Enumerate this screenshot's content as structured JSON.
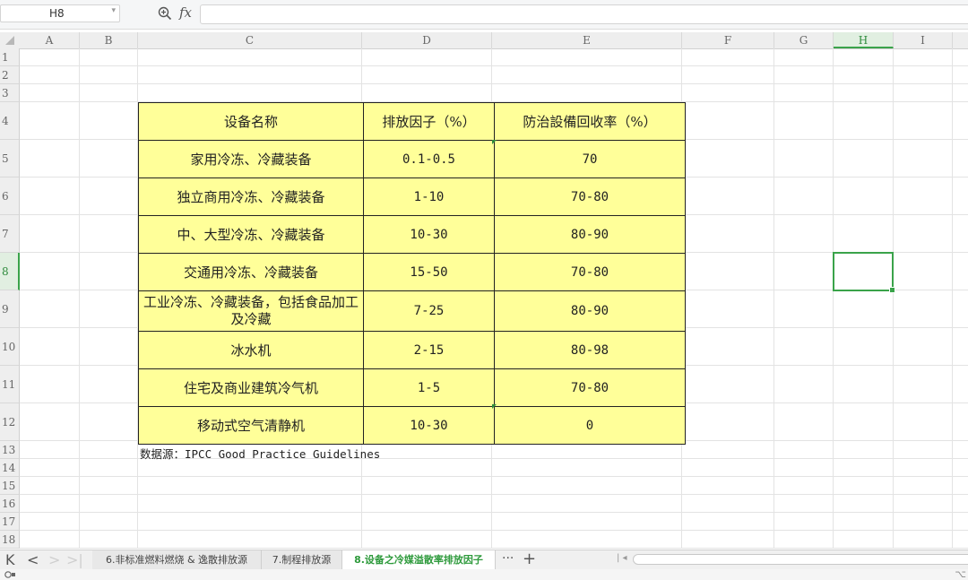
{
  "formula_bar": {
    "name_box": "H8",
    "fx_label": "fx",
    "formula": ""
  },
  "columns": [
    "A",
    "B",
    "C",
    "D",
    "E",
    "F",
    "G",
    "H",
    "I"
  ],
  "active_column": "H",
  "rows": [
    "1",
    "2",
    "3",
    "4",
    "5",
    "6",
    "7",
    "8",
    "9",
    "10",
    "11",
    "12",
    "13",
    "14",
    "15",
    "16",
    "17",
    "18"
  ],
  "active_row": "8",
  "table": {
    "headers": [
      "设备名称",
      "排放因子（%）",
      "防治設備回收率（%）"
    ],
    "rows": [
      [
        "家用冷冻、冷藏装备",
        "0.1-0.5",
        "70"
      ],
      [
        "独立商用冷冻、冷藏装备",
        "1-10",
        "70-80"
      ],
      [
        "中、大型冷冻、冷藏装备",
        "10-30",
        "80-90"
      ],
      [
        "交通用冷冻、冷藏装备",
        "15-50",
        "70-80"
      ],
      [
        "工业冷冻、冷藏装备，包括食品加工及冷藏",
        "7-25",
        "80-90"
      ],
      [
        "冰水机",
        "2-15",
        "80-98"
      ],
      [
        "住宅及商业建筑冷气机",
        "1-5",
        "70-80"
      ],
      [
        "移动式空气清静机",
        "10-30",
        "0"
      ]
    ],
    "source_note": "数据源：IPCC Good Practice Guidelines",
    "fill_color": "#ffff99"
  },
  "sheet_tabs": [
    {
      "label": "6.非标准燃料燃烧 & 逸散排放源",
      "active": false
    },
    {
      "label": "7.制程排放源",
      "active": false
    },
    {
      "label": "8.设备之冷媒溢散率排放因子",
      "active": true
    }
  ],
  "tab_controls": {
    "first": "K",
    "prev": "<",
    "next": ">",
    "last": ">|",
    "more": "···",
    "add": "+"
  },
  "accent_color": "#3aa34a"
}
